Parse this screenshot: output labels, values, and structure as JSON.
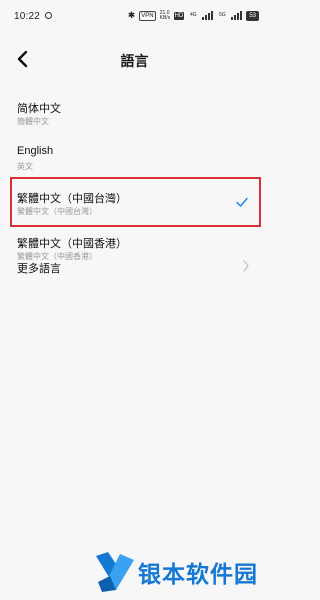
{
  "status_bar": {
    "time": "10:22",
    "bt": "✱",
    "vpn": "VPN",
    "speed_top": "21.0",
    "speed_bottom": "KB/s",
    "hd": "HD",
    "net1": "4G",
    "net2": "5G",
    "battery": "53"
  },
  "header": {
    "title": "語言"
  },
  "languages": [
    {
      "primary": "简体中文",
      "secondary": "簡體中文",
      "selected": false
    },
    {
      "primary": "English",
      "secondary": "英文",
      "selected": false
    },
    {
      "primary": "繁體中文（中國台灣）",
      "secondary": "繁體中文（中國台灣）",
      "selected": true
    },
    {
      "primary": "繁體中文（中國香港）",
      "secondary": "繁體中文（中國香港）",
      "selected": false
    }
  ],
  "more_languages": {
    "label": "更多語言"
  },
  "watermark": {
    "text": "银本软件园"
  },
  "colors": {
    "accent": "#1e88e5",
    "highlight_border": "#d93036",
    "background": "#f7f7f7",
    "secondary_text": "#9a9a9a",
    "watermark": "#1478d4"
  }
}
